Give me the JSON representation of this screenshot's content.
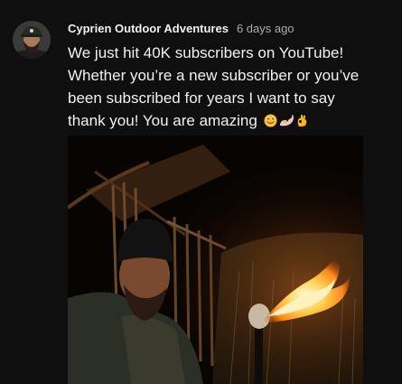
{
  "post": {
    "channel_name": "Cyprien Outdoor Adventures",
    "date": "6 days ago",
    "text_lines": [
      "We just hit 40K subscribers on YouTube!",
      "Whether you’re a new subscriber or you’ve",
      "been subscribed for years I want to say",
      "thank you! You are amazing"
    ],
    "emojis": [
      "smiling-face-icon",
      "flexed-biceps-icon",
      "ok-hand-icon"
    ],
    "avatar": "channel-avatar",
    "image": "man-with-torch-at-night-photo"
  },
  "colors": {
    "background": "#0f0f0f",
    "text_primary": "#f1f1f1",
    "text_secondary": "#aaaaaa"
  }
}
